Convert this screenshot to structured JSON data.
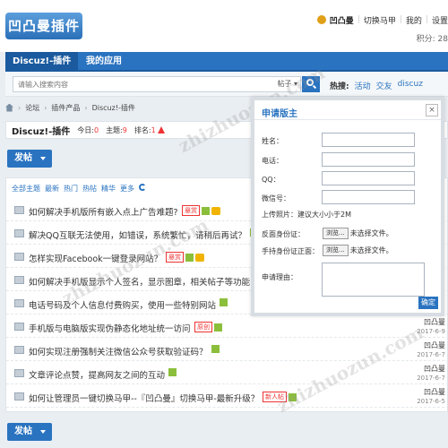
{
  "header": {
    "logo_text": "凹凸曼插件",
    "username": "凹凸曼",
    "links": [
      "切换马甲",
      "我的",
      "设置"
    ],
    "points_label": "积分: 28"
  },
  "nav": {
    "tabs": [
      "Discuz!-插件",
      "我的应用"
    ]
  },
  "search": {
    "placeholder": "请输入搜索内容",
    "scope": "帖子",
    "hot_label": "热搜:",
    "hot_links": [
      "活动",
      "交友",
      "discuz"
    ]
  },
  "breadcrumb": [
    "论坛",
    "插件产品",
    "Discuz!-插件"
  ],
  "forum": {
    "name": "Discuz!-插件",
    "today_label": "今日:",
    "today": "0",
    "topics_label": "主题:",
    "topics": "9",
    "rank_label": "排名:",
    "rank": "1"
  },
  "post_button": "发帖",
  "filters": [
    "全部主题",
    "最新",
    "热门",
    "热帖",
    "精华",
    "更多"
  ],
  "threads": [
    {
      "title": "如何解决手机版所有嵌入点上广告难题?",
      "badge": "悬赏",
      "author": "",
      "date": ""
    },
    {
      "title": "解决QQ互联无法使用，如错误，系统繁忙，请稍后再试？",
      "badge": "",
      "author": "",
      "date": ""
    },
    {
      "title": "怎样实现Facebook一键登录网站？",
      "badge": "悬赏",
      "author": "",
      "date": ""
    },
    {
      "title": "如何解决手机版显示个人签名，显示图章，相关帖子等功能",
      "badge": "",
      "author": "",
      "date": ""
    },
    {
      "title": "电话号码及个人信息付费购买，使用一些特别网站",
      "badge": "",
      "author": "",
      "date": ""
    },
    {
      "title": "手机版与电脑版实现伪静态化地址统一访问",
      "badge": "原创",
      "author": "凹凸曼",
      "date": "2017-6-9"
    },
    {
      "title": "如何实现注册强制关注微信公众号获取验证码？",
      "badge": "",
      "author": "凹凸曼",
      "date": "2017-6-7"
    },
    {
      "title": "文章评论点赞，提高网友之间的互动",
      "badge": "",
      "author": "凹凸曼",
      "date": "2017-6-7"
    },
    {
      "title": "如何让管理员一键切换马甲--『凹凸曼』切换马甲-最新升级？",
      "badge": "新人帖",
      "author": "凹凸曼",
      "date": "2017-6-5"
    }
  ],
  "modal": {
    "title": "申请版主",
    "close": "×",
    "fields": [
      "姓名：",
      "电话：",
      "QQ：",
      "微信号："
    ],
    "upload_note": "上传照片：建议大小小于2M",
    "id_back_label": "反面身份证：",
    "id_front_label": "手持身份证正面：",
    "browse_label": "浏览...",
    "no_file": "未选择文件。",
    "reason_label": "申请理由：",
    "confirm": "确定"
  },
  "watermark": "zhizhuozun.com",
  "colors": {
    "primary": "#2a73c0",
    "accent_red": "#ee3333",
    "background": "#e9eef2"
  }
}
